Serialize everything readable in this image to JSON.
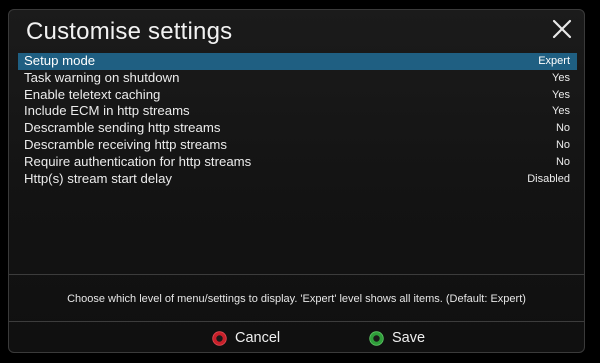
{
  "dialog": {
    "title": "Customise settings",
    "close_icon": "close-icon"
  },
  "settings": [
    {
      "label": "Setup mode",
      "value": "Expert",
      "selected": true
    },
    {
      "label": "Task warning on shutdown",
      "value": "Yes",
      "selected": false
    },
    {
      "label": "Enable teletext caching",
      "value": "Yes",
      "selected": false
    },
    {
      "label": "Include ECM in http streams",
      "value": "Yes",
      "selected": false
    },
    {
      "label": "Descramble sending http streams",
      "value": "No",
      "selected": false
    },
    {
      "label": "Descramble receiving http streams",
      "value": "No",
      "selected": false
    },
    {
      "label": "Require authentication for http streams",
      "value": "No",
      "selected": false
    },
    {
      "label": "Http(s) stream start delay",
      "value": "Disabled",
      "selected": false
    }
  ],
  "help_text": "Choose which level of menu/settings to display. 'Expert' level shows all items.  (Default: Expert)",
  "buttons": {
    "cancel": {
      "label": "Cancel",
      "color": "#c8202a",
      "icon": "red-button-icon"
    },
    "save": {
      "label": "Save",
      "color": "#2f9e3a",
      "icon": "green-button-icon"
    }
  },
  "colors": {
    "selection": "#1f5f82",
    "background": "#141414",
    "text": "#ececec"
  }
}
